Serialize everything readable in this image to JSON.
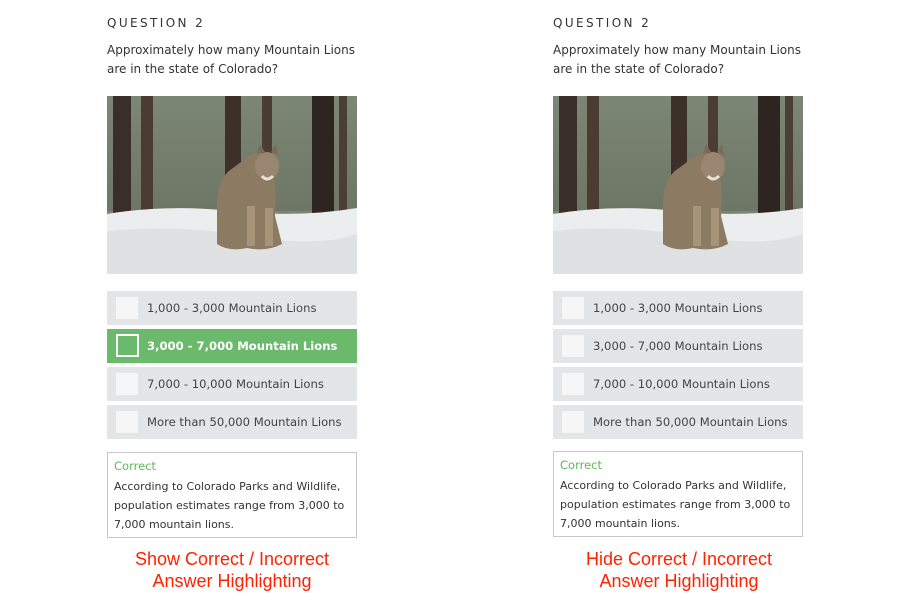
{
  "panels": [
    {
      "question_label": "QUESTION 2",
      "question_text": "Approximately how many Mountain Lions are in the state of Colorado?",
      "options": [
        {
          "label": "1,000 - 3,000 Mountain Lions",
          "highlighted": false
        },
        {
          "label": "3,000 - 7,000 Mountain Lions",
          "highlighted": true
        },
        {
          "label": "7,000 - 10,000 Mountain Lions",
          "highlighted": false
        },
        {
          "label": "More than 50,000 Mountain Lions",
          "highlighted": false
        }
      ],
      "feedback": {
        "status": "Correct",
        "text": "According to Colorado Parks and Wildlife, population estimates range from 3,000 to 7,000 mountain lions."
      },
      "caption_line1": "Show Correct / Incorrect",
      "caption_line2": "Answer Highlighting"
    },
    {
      "question_label": "QUESTION 2",
      "question_text": "Approximately how many Mountain Lions are in the state of Colorado?",
      "options": [
        {
          "label": "1,000 - 3,000 Mountain Lions",
          "highlighted": false
        },
        {
          "label": "3,000 - 7,000 Mountain Lions",
          "highlighted": false
        },
        {
          "label": "7,000 - 10,000 Mountain Lions",
          "highlighted": false
        },
        {
          "label": "More than 50,000 Mountain Lions",
          "highlighted": false
        }
      ],
      "feedback": {
        "status": "Correct",
        "text": "According to Colorado Parks and Wildlife, population estimates range from 3,000 to 7,000 mountain lions."
      },
      "caption_line1": "Hide Correct / Incorrect",
      "caption_line2": "Answer Highlighting"
    }
  ],
  "colors": {
    "correct_green": "#6bb96b",
    "feedback_green": "#5cb85c",
    "option_gray": "#e4e5e6",
    "caption_red": "#ff2200"
  }
}
